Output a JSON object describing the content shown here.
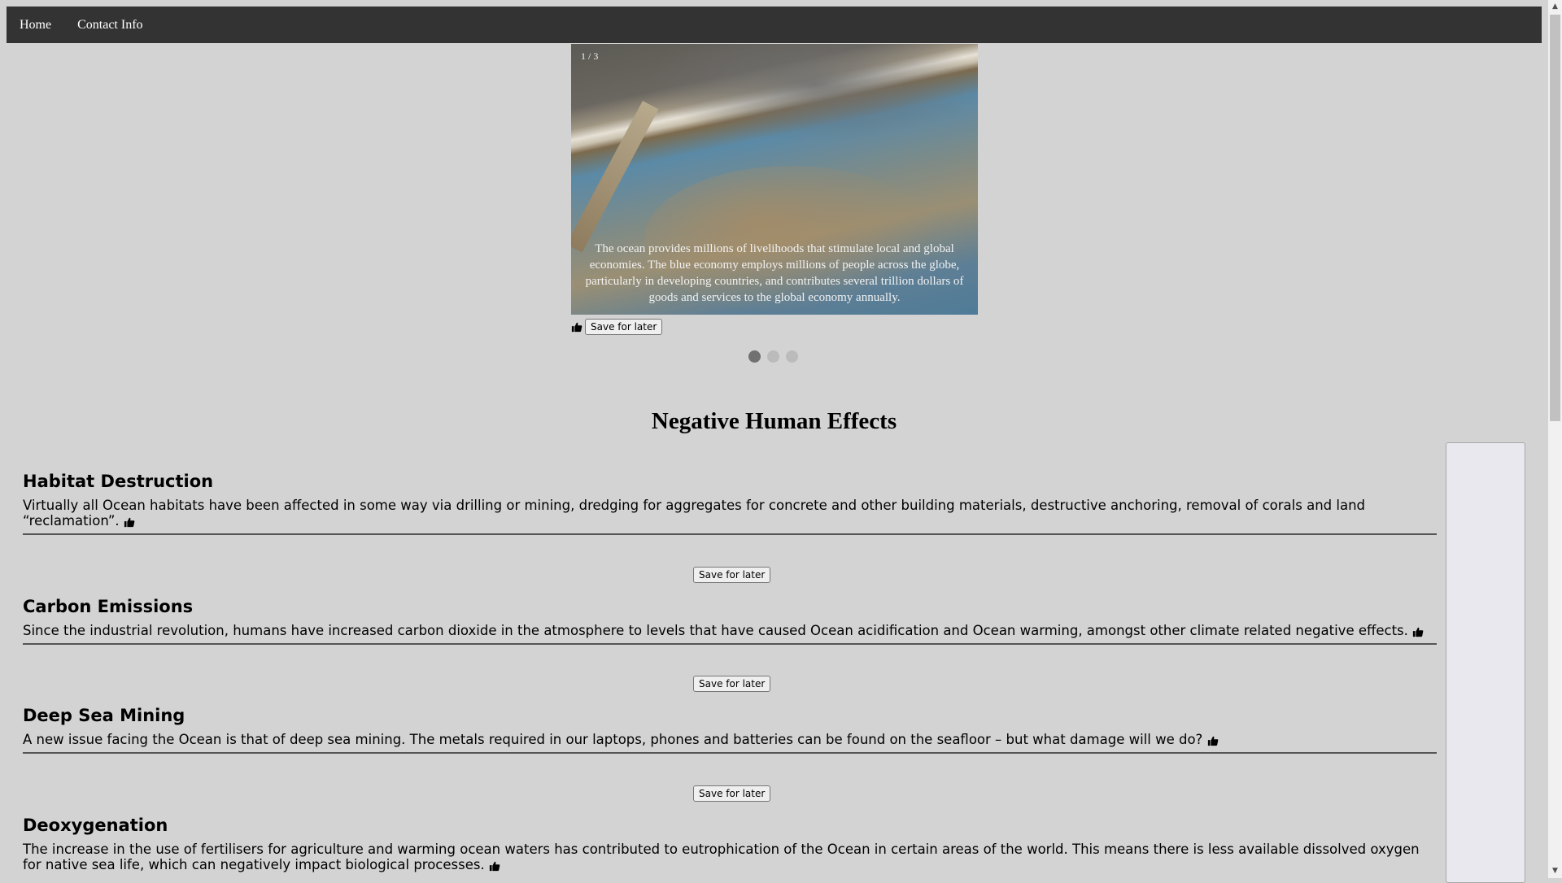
{
  "nav": {
    "home": "Home",
    "contact": "Contact Info"
  },
  "slideshow": {
    "counter": "1 / 3",
    "caption": "The ocean provides millions of livelihoods that stimulate local and global economies. The blue economy employs millions of people across the globe, particularly in developing countries, and contributes several trillion dollars of goods and services to the global economy annually.",
    "save_label": "Save for later",
    "dots": [
      true,
      false,
      false
    ]
  },
  "section": {
    "title": "Negative Human Effects"
  },
  "articles": [
    {
      "title": "Habitat Destruction",
      "body": "Virtually all Ocean habitats have been affected in some way via drilling or mining, dredging for aggregates for concrete and other building materials, destructive anchoring, removal of corals and land “reclamation”.",
      "save_label": "Save for later"
    },
    {
      "title": "Carbon Emissions",
      "body": "Since the industrial revolution, humans have increased carbon dioxide in the atmosphere to levels that have caused Ocean acidification and Ocean warming, amongst other climate related negative effects.",
      "save_label": "Save for later"
    },
    {
      "title": "Deep Sea Mining",
      "body": "A new issue facing the Ocean is that of deep sea mining. The metals required in our laptops, phones and batteries can be found on the seafloor – but what damage will we do?",
      "save_label": "Save for later"
    },
    {
      "title": "Deoxygenation",
      "body": "The increase in the use of fertilisers for agriculture and warming ocean waters has contributed to eutrophication of the Ocean in certain areas of the world. This means there is less available dissolved oxygen for native sea life, which can negatively impact biological processes."
    }
  ],
  "icons": {
    "like": "thumbs-up-icon"
  }
}
